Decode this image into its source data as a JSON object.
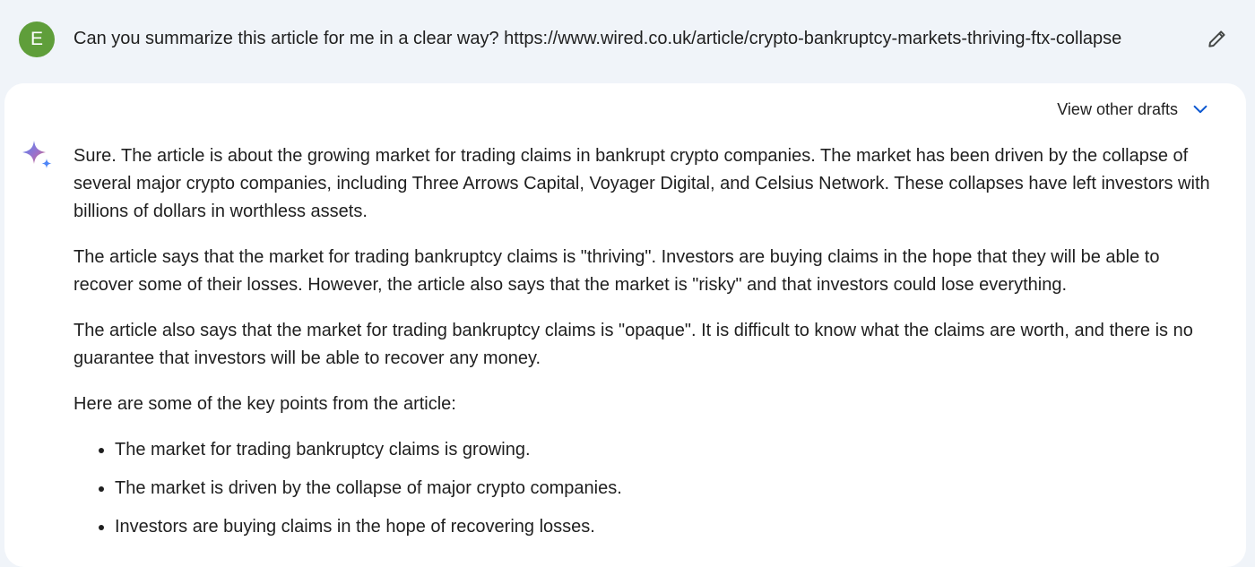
{
  "prompt": {
    "avatar_initial": "E",
    "avatar_color": "#5f9e3a",
    "text": "Can you summarize this article for me in a clear way? https://www.wired.co.uk/article/crypto-bankruptcy-markets-thriving-ftx-collapse",
    "edit_icon": "pencil-icon"
  },
  "response": {
    "drafts_label": "View other drafts",
    "drafts_icon": "chevron-down-icon",
    "assistant_icon": "sparkle-icon",
    "paragraphs": [
      "Sure. The article is about the growing market for trading claims in bankrupt crypto companies. The market has been driven by the collapse of several major crypto companies, including Three Arrows Capital, Voyager Digital, and Celsius Network. These collapses have left investors with billions of dollars in worthless assets.",
      "The article says that the market for trading bankruptcy claims is \"thriving\". Investors are buying claims in the hope that they will be able to recover some of their losses. However, the article also says that the market is \"risky\" and that investors could lose everything.",
      "The article also says that the market for trading bankruptcy claims is \"opaque\". It is difficult to know what the claims are worth, and there is no guarantee that investors will be able to recover any money.",
      "Here are some of the key points from the article:"
    ],
    "bullets": [
      "The market for trading bankruptcy claims is growing.",
      "The market is driven by the collapse of major crypto companies.",
      "Investors are buying claims in the hope of recovering losses."
    ]
  },
  "colors": {
    "page_background": "#f0f4f9",
    "card_background": "#ffffff",
    "accent_blue": "#0b57d0"
  }
}
